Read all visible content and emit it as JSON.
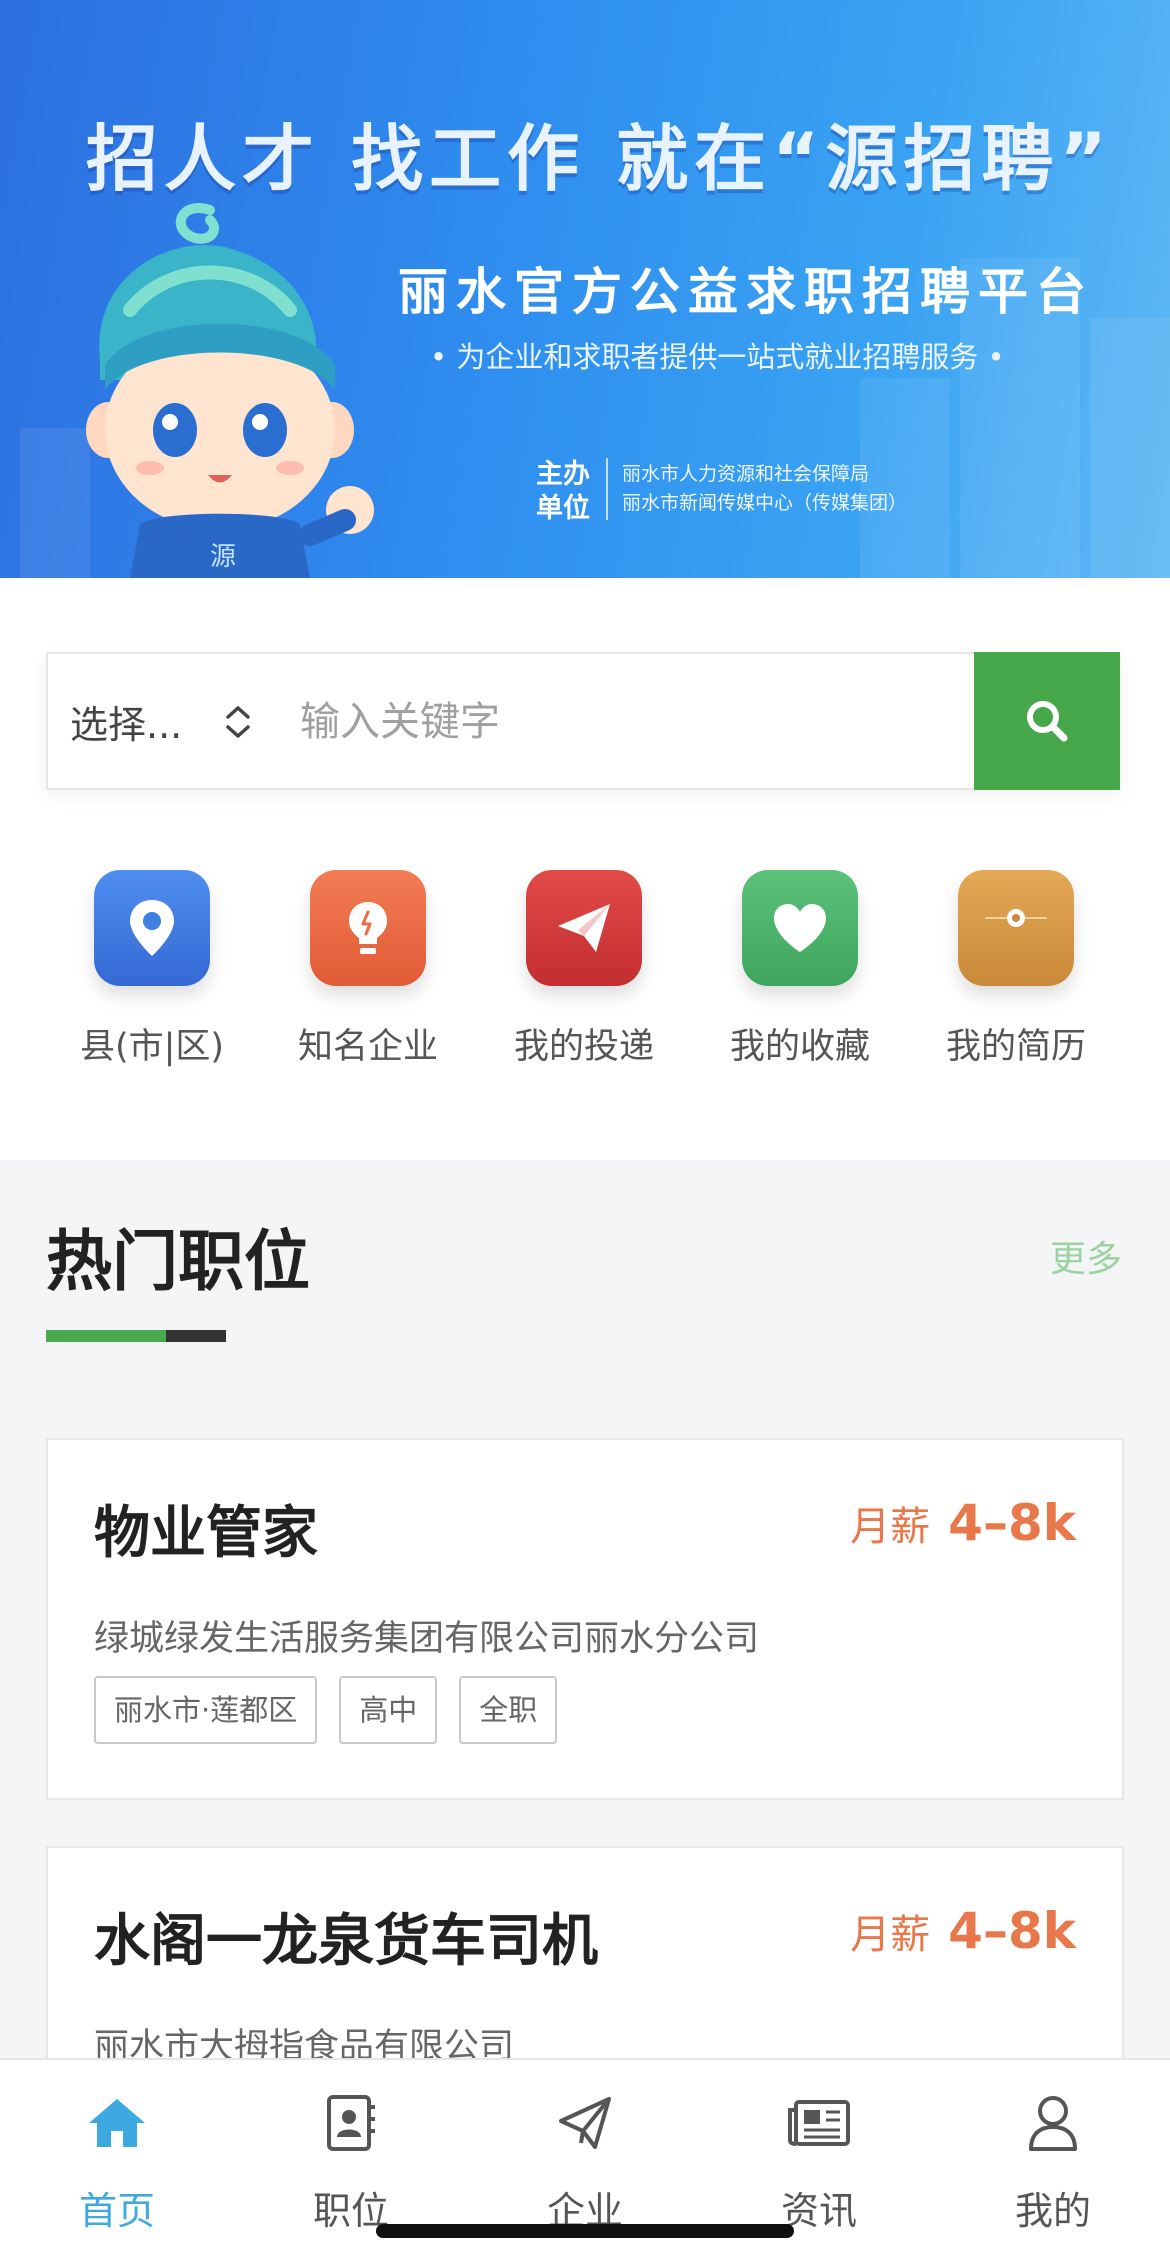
{
  "banner": {
    "slogan": "招人才  找工作   就在“源招聘”",
    "platform": "丽水官方公益求职招聘平台",
    "subtitle": "• 为企业和求职者提供一站式就业招聘服务 •",
    "sponsor_label": "主办单位",
    "sponsors": [
      "丽水市人力资源和社会保障局",
      "丽水市新闻传媒中心（传媒集团）"
    ],
    "mascot_text": "源"
  },
  "search": {
    "select_label": "选择...",
    "placeholder": "输入关键字",
    "button_color": "#46a84a"
  },
  "quick_nav": [
    {
      "label": "县(市|区)",
      "icon": "location-pin-icon",
      "color": "#3f7fe0"
    },
    {
      "label": "知名企业",
      "icon": "lightbulb-icon",
      "color": "#ec6a44"
    },
    {
      "label": "我的投递",
      "icon": "paper-plane-icon",
      "color": "#d83c3c"
    },
    {
      "label": "我的收藏",
      "icon": "heart-icon",
      "color": "#4cb56a"
    },
    {
      "label": "我的简历",
      "icon": "envelope-icon",
      "color": "#d99a45"
    }
  ],
  "hot_jobs": {
    "title": "热门职位",
    "more_label": "更多",
    "jobs": [
      {
        "title": "物业管家",
        "salary_label": "月薪",
        "salary": "4–8k",
        "company": "绿城绿发生活服务集团有限公司丽水分公司",
        "tags": [
          "丽水市·莲都区",
          "高中",
          "全职"
        ]
      },
      {
        "title": "水阁一龙泉货车司机",
        "salary_label": "月薪",
        "salary": "4–8k",
        "company": "丽水市大拇指食品有限公司",
        "tags": []
      }
    ]
  },
  "tab_bar": {
    "items": [
      {
        "label": "首页",
        "icon": "home-icon",
        "active": true
      },
      {
        "label": "职位",
        "icon": "contact-book-icon",
        "active": false
      },
      {
        "label": "企业",
        "icon": "paper-plane-icon",
        "active": false
      },
      {
        "label": "资讯",
        "icon": "newspaper-icon",
        "active": false
      },
      {
        "label": "我的",
        "icon": "user-icon",
        "active": false
      }
    ],
    "active_color": "#3ea8e0"
  },
  "colors": {
    "accent_green": "#46a84a",
    "salary_orange": "#e8784a",
    "banner_blue": "#2f8ff0"
  }
}
